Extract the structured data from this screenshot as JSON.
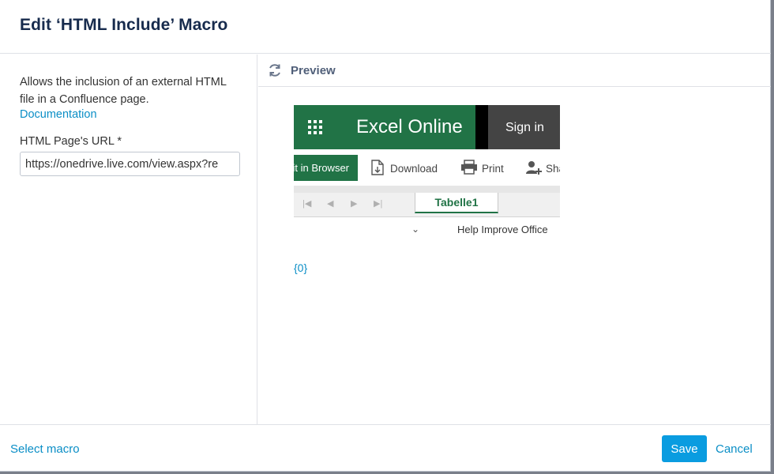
{
  "dialog": {
    "title": "Edit ‘HTML Include’ Macro"
  },
  "left_panel": {
    "description": "Allows the inclusion of an external HTML file in a Confluence page.",
    "documentation_link": "Documentation",
    "url_field": {
      "label": "HTML Page's URL *",
      "value": "https://onedrive.live.com/view.aspx?re"
    }
  },
  "preview": {
    "label": "Preview",
    "refresh_icon": "refresh-icon",
    "embed": {
      "app_name": "Excel Online",
      "sign_in": "Sign in",
      "toolbar": {
        "edit_partial": "Edit in Browser",
        "download": "Download",
        "print": "Print",
        "share": "Share"
      },
      "sheet_tab": "Tabelle1",
      "help": "Help Improve Office"
    },
    "placeholder": "{0}"
  },
  "footer": {
    "select_macro": "Select macro",
    "save": "Save",
    "cancel": "Cancel"
  },
  "colors": {
    "accent": "#0a8ec6",
    "primary_button": "#0a9ce0",
    "excel_green": "#217346",
    "title_text": "#172b4d"
  }
}
